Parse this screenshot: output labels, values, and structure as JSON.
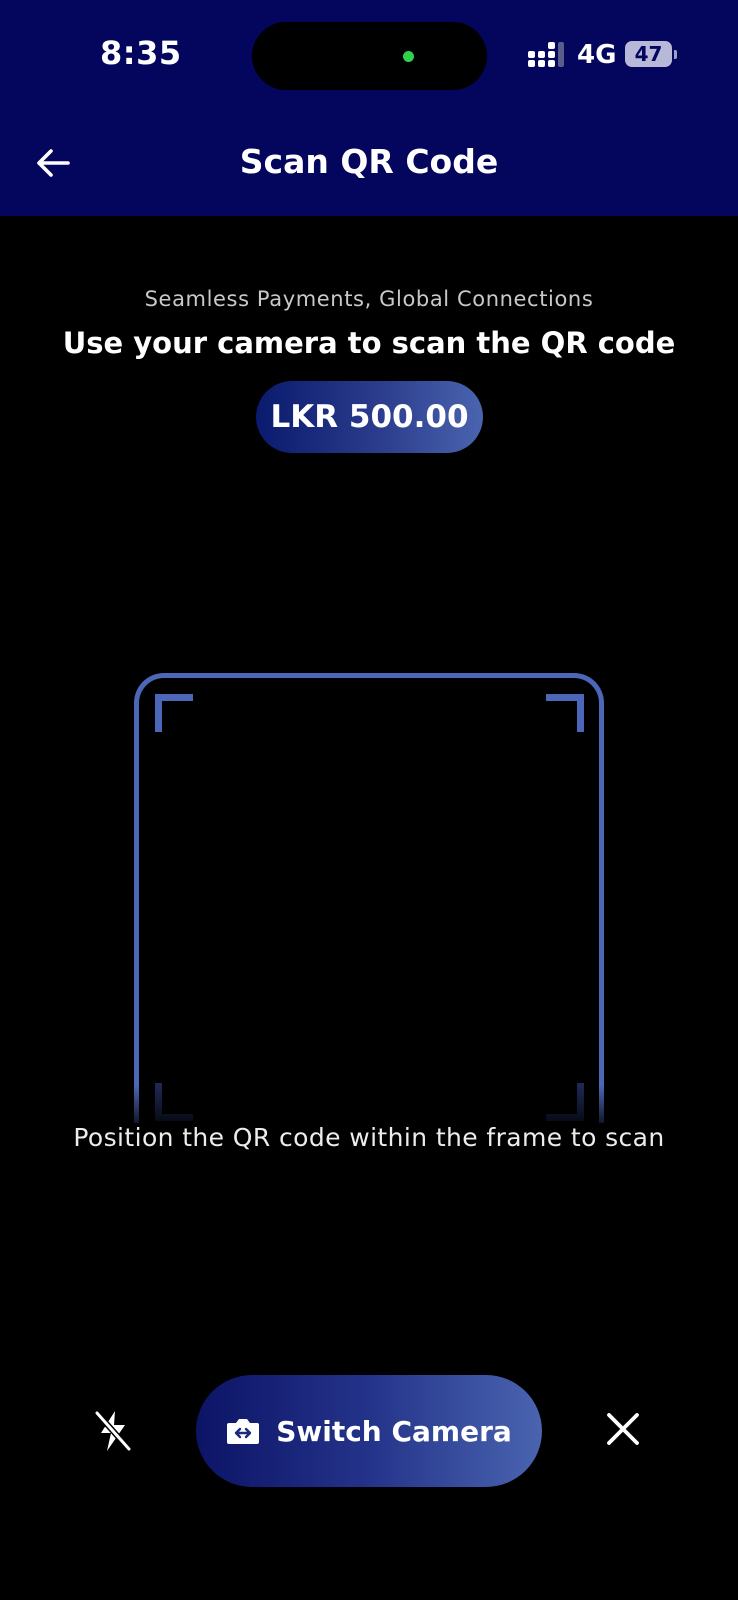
{
  "status_bar": {
    "time": "8:35",
    "network": "4G",
    "battery": "47",
    "battery_level": 0.47,
    "camera_indicator_color": "#2fd14d"
  },
  "header": {
    "title": "Scan QR Code",
    "back_icon": "arrow-left-icon",
    "background_color": "#03065c"
  },
  "content": {
    "tagline": "Seamless Payments, Global Connections",
    "instruction": "Use your camera to scan the QR code",
    "amount": "LKR 500.00",
    "hint": "Position the QR code within the frame to scan",
    "frame_color": "#4c67b8"
  },
  "controls": {
    "flash_icon": "flash-off-icon",
    "switch_camera_label": "Switch Camera",
    "switch_camera_icon": "camera-switch-icon",
    "close_icon": "close-icon"
  }
}
